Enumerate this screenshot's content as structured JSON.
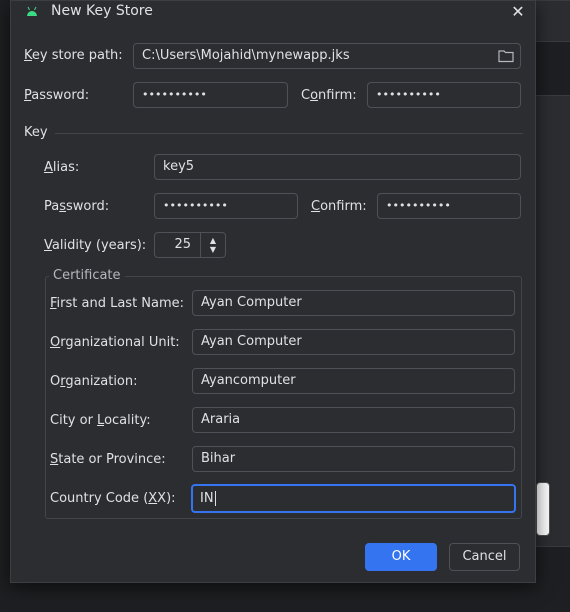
{
  "dialog": {
    "title": "New Key Store",
    "close_icon": "close-icon",
    "app_icon": "android-icon"
  },
  "keystore": {
    "path_label": "Key store path:",
    "path_value": "C:\\Users\\Mojahid\\mynewapp.jks",
    "password_label": "Password:",
    "password_value": "••••••••••",
    "confirm_label": "Confirm:",
    "confirm_value": "••••••••••"
  },
  "key": {
    "section_title": "Key",
    "alias_label": "Alias:",
    "alias_value": "key5",
    "password_label": "Password:",
    "password_value": "••••••••••",
    "confirm_label": "Confirm:",
    "confirm_value": "••••••••••",
    "validity_label": "Validity (years):",
    "validity_value": "25"
  },
  "certificate": {
    "legend": "Certificate",
    "fields": [
      {
        "label": "First and Last Name:",
        "value": "Ayan Computer"
      },
      {
        "label": "Organizational Unit:",
        "value": "Ayan Computer"
      },
      {
        "label": "Organization:",
        "value": "Ayancomputer"
      },
      {
        "label": "City or Locality:",
        "value": "Araria"
      },
      {
        "label": "State or Province:",
        "value": "Bihar"
      },
      {
        "label": "Country Code (XX):",
        "value": "IN"
      }
    ]
  },
  "buttons": {
    "ok": "OK",
    "cancel": "Cancel"
  },
  "colors": {
    "accent": "#3574f0",
    "background": "#2b2d30",
    "border": "#4e5157"
  }
}
